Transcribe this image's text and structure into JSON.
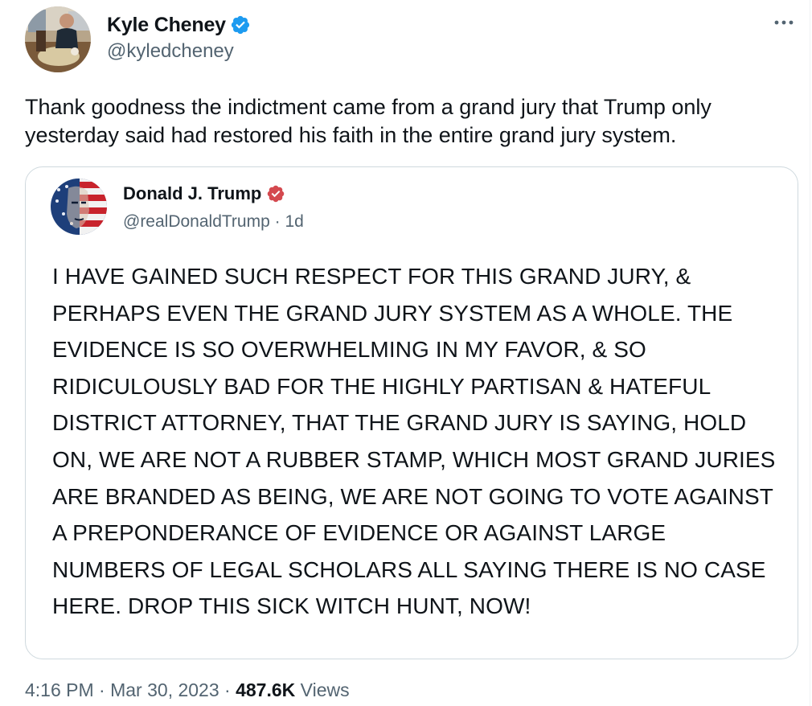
{
  "tweet": {
    "author": {
      "name": "Kyle Cheney",
      "handle": "@kyledcheney",
      "verified_color": "#1d9bf0"
    },
    "more_icon": "more-horizontal-icon",
    "text": "Thank goodness the indictment came from a grand jury that Trump only yesterday said had restored his faith in the entire grand jury system.",
    "quoted": {
      "author": {
        "name": "Donald J. Trump",
        "handle": "@realDonaldTrump",
        "verified_color": "#d4494f"
      },
      "separator": "·",
      "time": "1d",
      "text": "I HAVE GAINED SUCH RESPECT FOR THIS GRAND JURY, & PERHAPS EVEN THE GRAND JURY SYSTEM AS A WHOLE. THE EVIDENCE IS SO OVERWHELMING IN MY FAVOR, & SO RIDICULOUSLY BAD FOR THE HIGHLY PARTISAN & HATEFUL DISTRICT ATTORNEY, THAT THE GRAND JURY IS SAYING, HOLD ON, WE ARE NOT A RUBBER STAMP, WHICH MOST GRAND JURIES ARE BRANDED AS BEING, WE ARE NOT GOING TO VOTE AGAINST A PREPONDERANCE OF EVIDENCE OR AGAINST LARGE NUMBERS OF LEGAL SCHOLARS ALL SAYING THERE IS NO CASE HERE. DROP THIS SICK WITCH HUNT, NOW!"
    },
    "footer": {
      "time": "4:16 PM",
      "separator": "·",
      "date": "Mar 30, 2023",
      "views_count": "487.6K",
      "views_label": "Views"
    }
  }
}
